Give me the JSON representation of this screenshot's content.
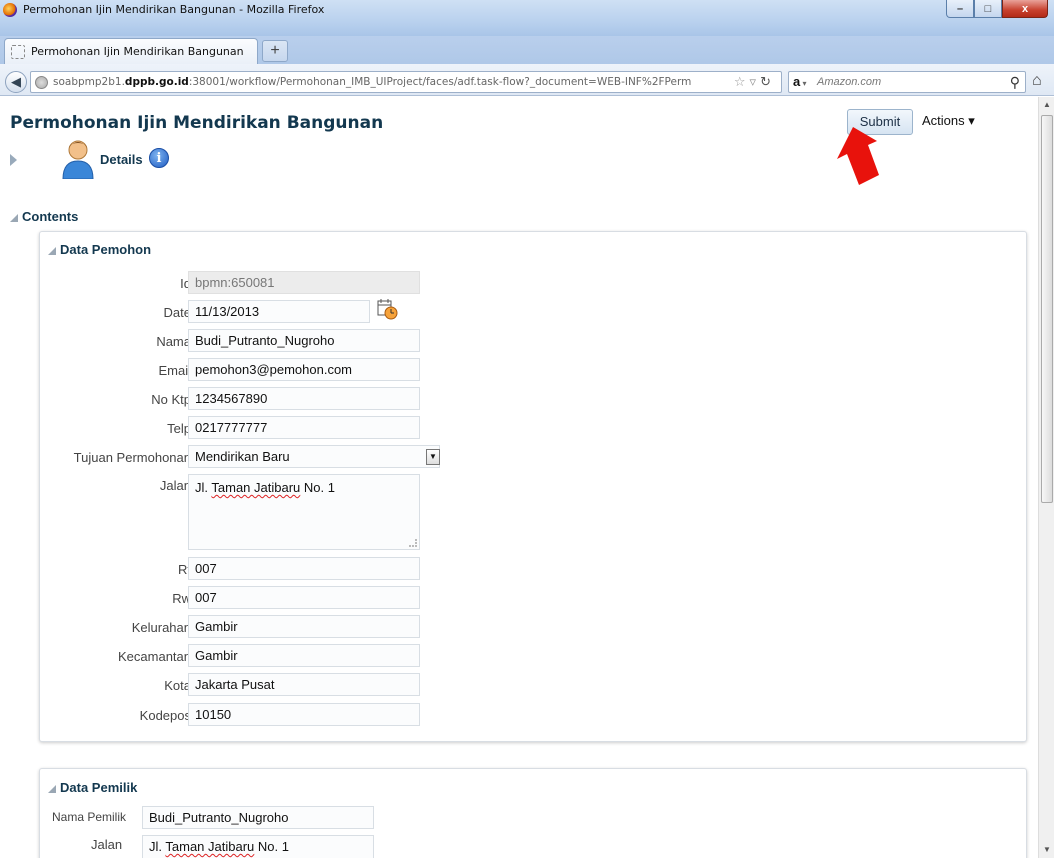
{
  "window": {
    "title": "Permohonan Ijin Mendirikan Bangunan - Mozilla Firefox",
    "minimize_label": "–",
    "maximize_label": "□",
    "close_label": "x"
  },
  "browser": {
    "tab_label": "Permohonan Ijin Mendirikan Bangunan",
    "new_tab_label": "+",
    "url_prefix": "soabpmp2b1.",
    "url_domain": "dppb.go.id",
    "url_rest": ":38001/workflow/Permohonan_IMB_UIProject/faces/adf.task-flow?_document=WEB-INF%2FPerm",
    "search_engine_icon": "a",
    "search_placeholder": "Amazon.com"
  },
  "page": {
    "title": "Permohonan Ijin Mendirikan Bangunan",
    "submit_label": "Submit",
    "actions_label": "Actions ▾",
    "details_label": "Details",
    "contents_label": "Contents"
  },
  "data_pemohon": {
    "heading": "Data Pemohon",
    "fields": [
      {
        "label": "Id",
        "value": "bpmn:650081"
      },
      {
        "label": "Date",
        "value": "11/13/2013"
      },
      {
        "label": "Nama",
        "value": "Budi_Putranto_Nugroho"
      },
      {
        "label": "Email",
        "value": "pemohon3@pemohon.com"
      },
      {
        "label": "No Ktp",
        "value": "1234567890"
      },
      {
        "label": "Telp",
        "value": "0217777777"
      },
      {
        "label": "Tujuan Permohonan",
        "value": "Mendirikan Baru"
      },
      {
        "label": "Jalan",
        "value_prefix": "Jl. ",
        "value_spell": "Taman Jatibaru",
        "value_suffix": " No. 1"
      },
      {
        "label": "Rt",
        "value": "007"
      },
      {
        "label": "Rw",
        "value": "007"
      },
      {
        "label": "Kelurahan",
        "value": "Gambir"
      },
      {
        "label": "Kecamantan",
        "value": "Gambir"
      },
      {
        "label": "Kota",
        "value": "Jakarta Pusat"
      },
      {
        "label": "Kodepos",
        "value": "10150"
      }
    ]
  },
  "data_pemilik": {
    "heading": "Data Pemilik",
    "fields": [
      {
        "label": "Nama Pemilik",
        "value": "Budi_Putranto_Nugroho"
      },
      {
        "label": "Jalan",
        "value_prefix": "Jl. ",
        "value_spell": "Taman Jatibaru",
        "value_suffix": " No. 1"
      }
    ]
  },
  "colors": {
    "title_color": "#13384f",
    "annotation_arrow": "#e8120c"
  }
}
